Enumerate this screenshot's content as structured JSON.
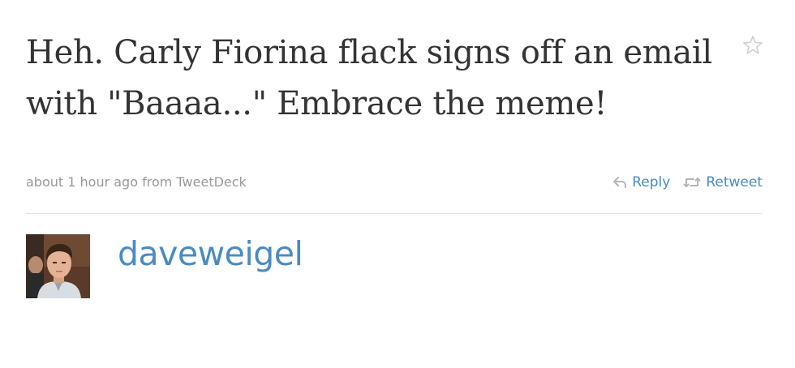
{
  "tweet": {
    "text": "Heh. Carly Fiorina flack signs off an email with \"Baaaa...\" Embrace the meme!",
    "timestamp": "about 1 hour ago",
    "from_label": "from",
    "source": "TweetDeck"
  },
  "actions": {
    "reply_label": "Reply",
    "retweet_label": "Retweet"
  },
  "author": {
    "screen_name": "daveweigel"
  },
  "icons": {
    "favorite": "star-outline-icon",
    "reply": "reply-arrow-icon",
    "retweet": "retweet-icon"
  },
  "colors": {
    "text": "#333333",
    "meta": "#999999",
    "link": "#4a8bc2",
    "divider": "#e3e3e3"
  }
}
